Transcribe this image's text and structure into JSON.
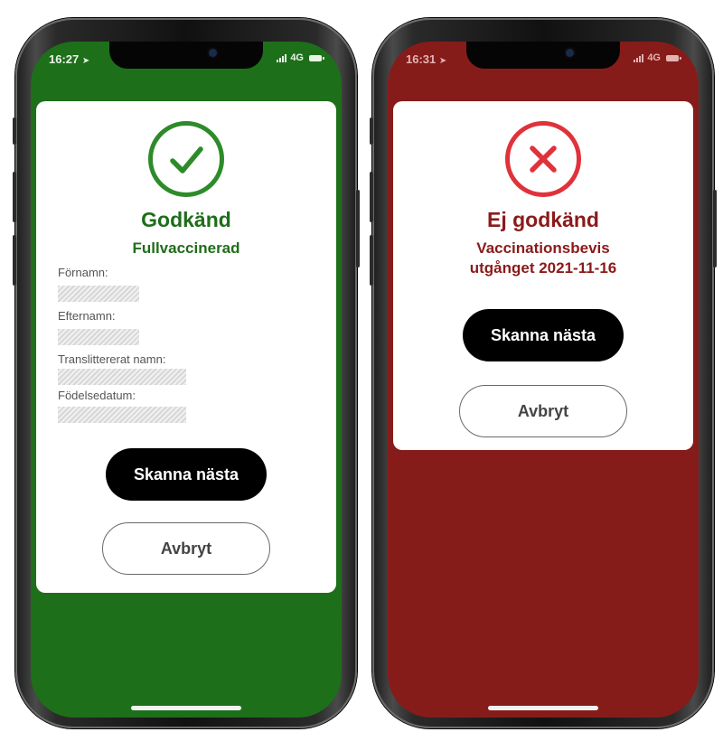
{
  "left_phone": {
    "status_bar": {
      "time": "16:27",
      "network": "4G"
    },
    "result": {
      "title": "Godkänd",
      "subtitle": "Fullvaccinerad",
      "icon": "checkmark-icon",
      "color": "#1e6f1a"
    },
    "fields": [
      {
        "label": "Förnamn:"
      },
      {
        "label": "Efternamn:"
      },
      {
        "label": "Translittererat namn:"
      },
      {
        "label": "Födelsedatum:"
      }
    ],
    "buttons": {
      "scan_next": "Skanna nästa",
      "cancel": "Avbryt"
    }
  },
  "right_phone": {
    "status_bar": {
      "time": "16:31",
      "network": "4G"
    },
    "result": {
      "title": "Ej godkänd",
      "subtitle_line1": "Vaccinationsbevis",
      "subtitle_line2": "utgånget 2021-11-16",
      "icon": "cross-icon",
      "color": "#861c1a"
    },
    "buttons": {
      "scan_next": "Skanna nästa",
      "cancel": "Avbryt"
    }
  }
}
